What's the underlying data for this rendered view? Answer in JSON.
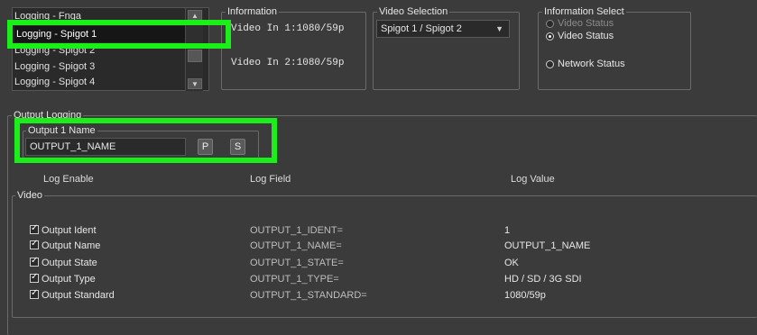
{
  "logging_list": {
    "items": [
      "Logging - Fnga",
      "Logging - Spigot 1",
      "Logging - Spigot 2",
      "Logging - Spigot 3",
      "Logging - Spigot 4"
    ],
    "selected_index": 1,
    "scroll_up": "▲",
    "scroll_down": "▼"
  },
  "information": {
    "title": "Information",
    "line1": "Video In 1:1080/59p",
    "line2": "Video In 2:1080/59p"
  },
  "video_selection": {
    "title": "Video Selection",
    "value": "Spigot 1 / Spigot 2",
    "arrow": "▼"
  },
  "information_select": {
    "title": "Information Select",
    "options": [
      "Video Status",
      "Video Status",
      "Network Status"
    ],
    "selected_index": 1
  },
  "output_logging": {
    "title": "Output Logging",
    "output_name_title": "Output 1 Name",
    "output_name_value": "OUTPUT_1_NAME",
    "p_button": "P",
    "s_button": "S"
  },
  "log_table": {
    "headers": {
      "enable": "Log Enable",
      "field": "Log Field",
      "value": "Log Value"
    },
    "group_title": "Video",
    "rows": [
      {
        "label": "Output Ident",
        "field": "OUTPUT_1_IDENT=",
        "value": "1",
        "checked": true
      },
      {
        "label": "Output Name",
        "field": "OUTPUT_1_NAME=",
        "value": "OUTPUT_1_NAME",
        "checked": true
      },
      {
        "label": "Output State",
        "field": "OUTPUT_1_STATE=",
        "value": "OK",
        "checked": true
      },
      {
        "label": "Output Type",
        "field": "OUTPUT_1_TYPE=",
        "value": "HD / SD / 3G SDI",
        "checked": true
      },
      {
        "label": "Output Standard",
        "field": "OUTPUT_1_STANDARD=",
        "value": "1080/59p",
        "checked": true
      }
    ],
    "check_glyph": "✓"
  },
  "colors": {
    "highlight": "#1aef1a",
    "background": "#3b3b3b",
    "field_bg": "#2a2a2a"
  }
}
